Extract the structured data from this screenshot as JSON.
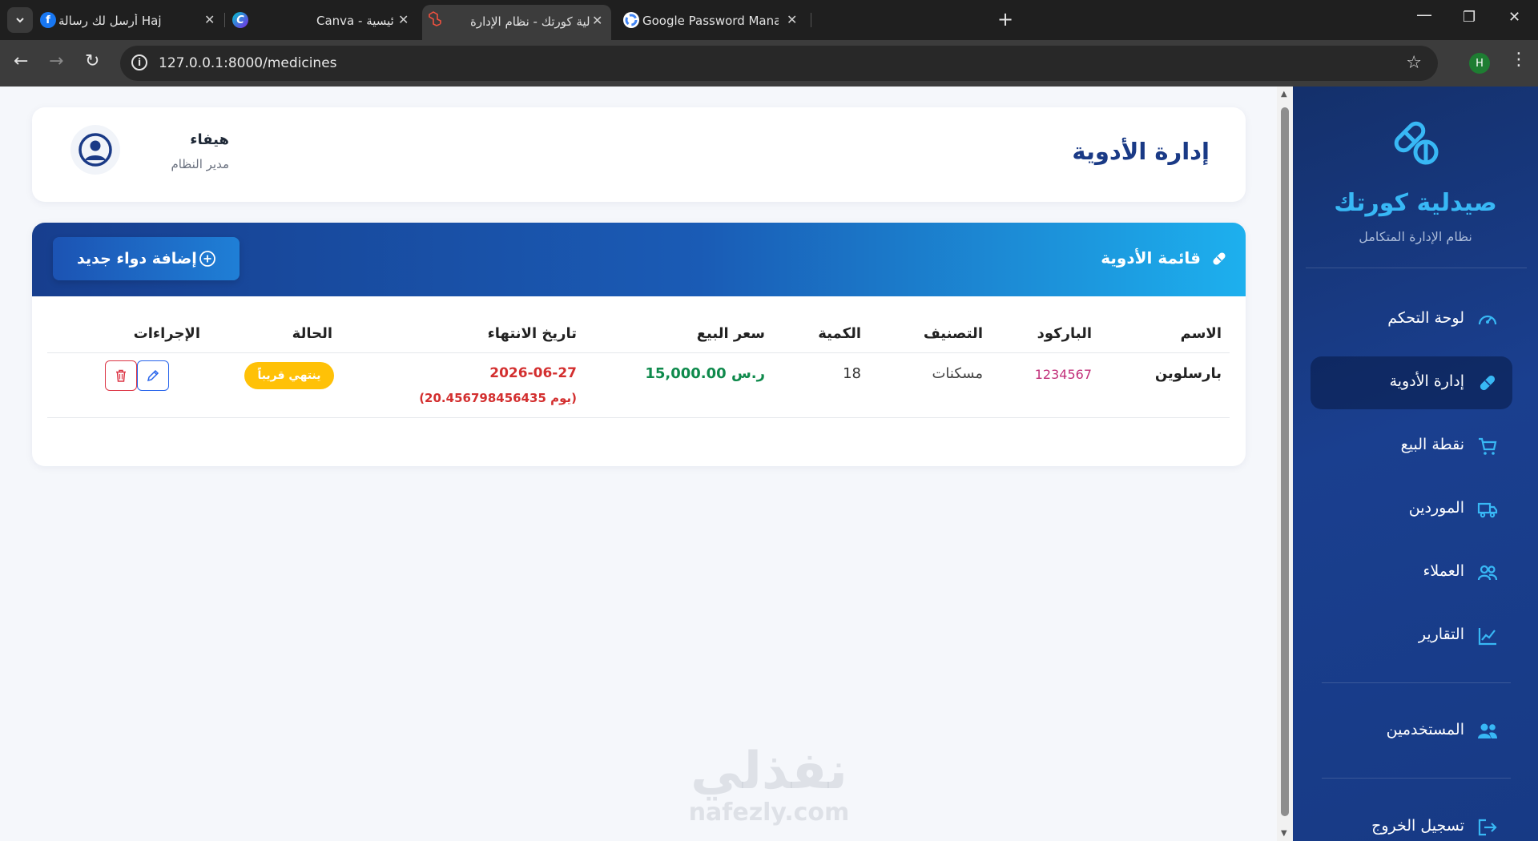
{
  "browser": {
    "tabs": [
      {
        "title": "أرسل لك رسالة Haj",
        "favicon": "facebook-icon"
      },
      {
        "title": "Canva - الرئيسية",
        "favicon": "canva-icon"
      },
      {
        "title": "صيدلية كورتك - نظام الإدارة",
        "favicon": "laravel-icon",
        "active": true
      },
      {
        "title": "Google Password Manager",
        "favicon": "google-icon"
      }
    ],
    "url": "127.0.0.1:8000/medicines",
    "profile_initial": "H"
  },
  "sidebar": {
    "brand_name": "صيدلية كورتك",
    "brand_subtitle": "نظام الإدارة المتكامل",
    "items": [
      {
        "label": "لوحة التحكم",
        "icon": "dashboard-gauge-icon"
      },
      {
        "label": "إدارة الأدوية",
        "icon": "pill-icon",
        "active": true
      },
      {
        "label": "نقطة البيع",
        "icon": "cart-icon"
      },
      {
        "label": "الموردين",
        "icon": "truck-icon"
      },
      {
        "label": "العملاء",
        "icon": "customers-icon"
      },
      {
        "label": "التقارير",
        "icon": "chart-line-icon"
      },
      {
        "label": "المستخدمين",
        "icon": "users-icon"
      },
      {
        "label": "تسجيل الخروج",
        "icon": "logout-icon"
      }
    ]
  },
  "header": {
    "title": "إدارة الأدوية",
    "user_name": "هيفاء",
    "user_role": "مدير النظام"
  },
  "medicines": {
    "list_title": "قائمة الأدوية",
    "add_button_label": "إضافة دواء جديد",
    "columns": {
      "name": "الاسم",
      "barcode": "الباركود",
      "category": "التصنيف",
      "quantity": "الكمية",
      "price": "سعر البيع",
      "expiry": "تاريخ الانتهاء",
      "status": "الحالة",
      "actions": "الإجراءات"
    },
    "rows": [
      {
        "name": "بارسلوين",
        "barcode": "1234567",
        "category": "مسكنات",
        "quantity": "18",
        "price": "15,000.00 ر.س",
        "expiry": "2026-06-27",
        "days_remaining": "(20.456798456435 يوم)",
        "status": "ينتهي قريباً"
      }
    ]
  },
  "watermark": {
    "arabic": "نفذلي",
    "latin": "nafezly.com"
  },
  "colors": {
    "primary": "#1a3a86",
    "accent": "#38b8f5",
    "success": "#0f8a4c",
    "danger": "#d32f2f",
    "warning": "#ffc107",
    "barcode": "#c2307a"
  }
}
